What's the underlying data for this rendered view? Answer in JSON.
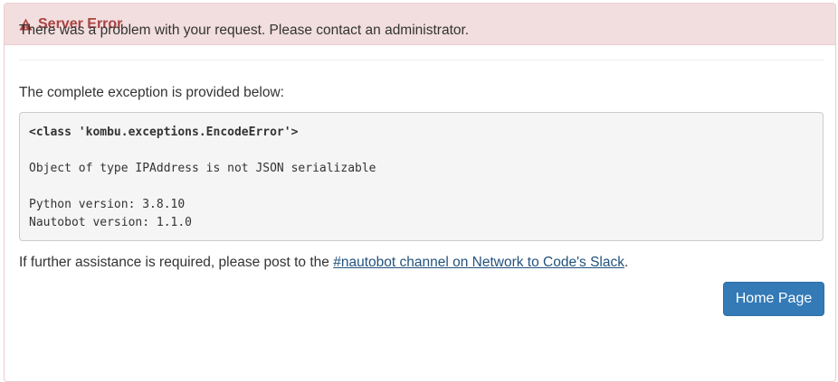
{
  "panel": {
    "title": "Server Error",
    "icon": "warning-icon",
    "heading_color": "#a94442",
    "heading_bg": "#f2dede"
  },
  "body": {
    "message": "There was a problem with your request. Please contact an administrator.",
    "exception_label": "The complete exception is provided below:",
    "exception_class": "<class 'kombu.exceptions.EncodeError'>",
    "exception_message": "Object of type IPAddress is not JSON serializable",
    "python_version": "Python version: 3.8.10",
    "nautobot_version": "Nautobot version: 1.1.0",
    "assist_prefix": "If further assistance is required, please post to the ",
    "assist_link": "#nautobot channel on Network to Code's Slack",
    "assist_suffix": "."
  },
  "actions": {
    "home_label": "Home Page",
    "home_color": "#337ab7"
  }
}
